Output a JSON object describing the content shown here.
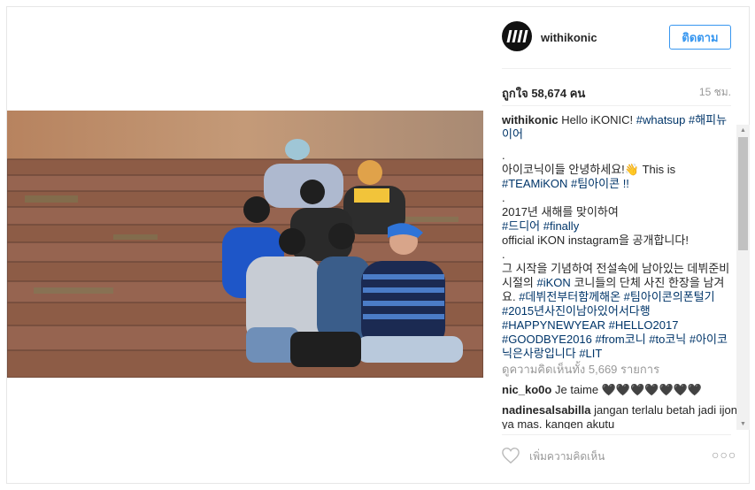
{
  "post": {
    "username": "withikonic",
    "follow_label": "ติดตาม",
    "likes_text": "ถูกใจ 58,674 คน",
    "time_ago": "15 ชม.",
    "caption": {
      "user": "withikonic",
      "line1_text": "Hello iKONIC!",
      "line1_tags": "#whatsup #해피뉴이어",
      "dot1": ".",
      "line2_text": "아이코닉이들 안녕하세요!👋 This is",
      "line2_tags": "#TEAMiKON #팀아이콘 !!",
      "dot2": ".",
      "line3_a": "2017년 새해를 맞이하여",
      "line3_tags": "#드디어 #finally",
      "line3_b": "official iKON instagram을 공개합니다!",
      "dot3": ".",
      "line4": "그 시작을 기념하여 전설속에 남아있는 데뷔준비시절의",
      "line4_tag1": "#iKON",
      "line4_mid": "코니들의 단체 사진 한장을 남겨요.",
      "line4_tags": "#데뷔전부터함께해온 #팀아이콘의폰털기 #2015년사진이남아있어서다행 #HAPPYNEWYEAR #HELLO2017 #GOODBYE2016 #from코니 #to코닉 #아이코닉은사랑입니다 #LIT"
    },
    "view_all_comments": "ดูความคิดเห็นทั้ง 5,669 รายการ",
    "comments": [
      {
        "user": "nic_ko0o",
        "text": "Je taime 🖤🖤🖤🖤🖤🖤🖤"
      },
      {
        "user": "nadinesalsabilla",
        "text": "jangan terlalu betah jadi ijon ya mas. kangen akutu"
      }
    ],
    "add_comment_placeholder": "เพิ่มความคิดเห็น",
    "more_label": "○○○",
    "photo_alt": "iKON group photo on wooden steps"
  },
  "colors": {
    "link": "#003569",
    "follow": "#3897f0",
    "muted": "#999999"
  },
  "icons": {
    "heart": "heart-outline-icon",
    "more": "more-options-icon"
  }
}
